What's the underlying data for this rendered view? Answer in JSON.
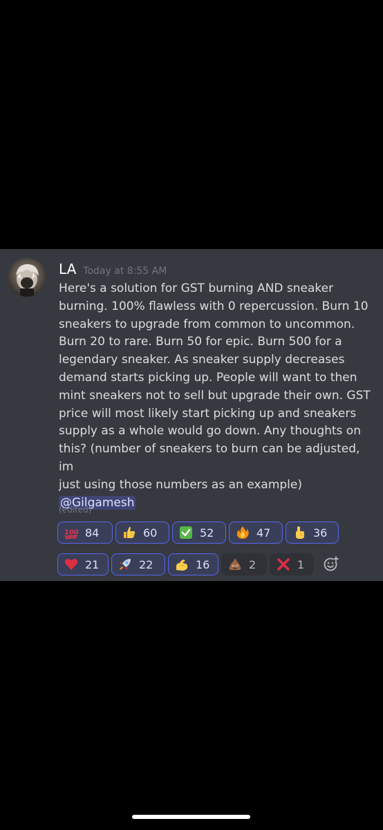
{
  "message": {
    "username": "LA",
    "timestamp": "Today at 8:55 AM",
    "text_before_mention": "Here's a solution for GST burning AND sneaker\nburning. 100% flawless with 0 repercussion. Burn 10\nsneakers to upgrade from common to uncommon.\nBurn 20 to rare. Burn 50 for epic. Burn 500 for a\nlegendary sneaker. As sneaker supply decreases\ndemand starts picking up. People will want to then\nmint sneakers not to sell but upgrade their own. GST\nprice will most likely start picking up and sneakers\nsupply as a whole would go down. Any thoughts on\nthis? (number of sneakers to burn can be adjusted, im\njust using those numbers as an example) ",
    "mention": "@Gilgamesh",
    "edited_label": "(edited)"
  },
  "reactions": [
    {
      "emoji": "hundred-points-icon",
      "count": "84",
      "reacted": true
    },
    {
      "emoji": "thumbs-up-icon",
      "count": "60",
      "reacted": true
    },
    {
      "emoji": "check-mark-button-icon",
      "count": "52",
      "reacted": true
    },
    {
      "emoji": "fire-icon",
      "count": "47",
      "reacted": true
    },
    {
      "emoji": "pointing-up-icon",
      "count": "36",
      "reacted": true
    },
    {
      "emoji": "red-heart-icon",
      "count": "21",
      "reacted": true
    },
    {
      "emoji": "rocket-icon",
      "count": "22",
      "reacted": true
    },
    {
      "emoji": "flexed-biceps-icon",
      "count": "16",
      "reacted": true
    },
    {
      "emoji": "pile-of-poo-icon",
      "count": "2",
      "reacted": false
    },
    {
      "emoji": "cross-mark-icon",
      "count": "1",
      "reacted": false
    }
  ],
  "add_reaction_icon": "add-reaction-icon",
  "colors": {
    "card_background": "#36393f",
    "reaction_border": "#5865f2",
    "mention_text": "#dee0fc"
  }
}
